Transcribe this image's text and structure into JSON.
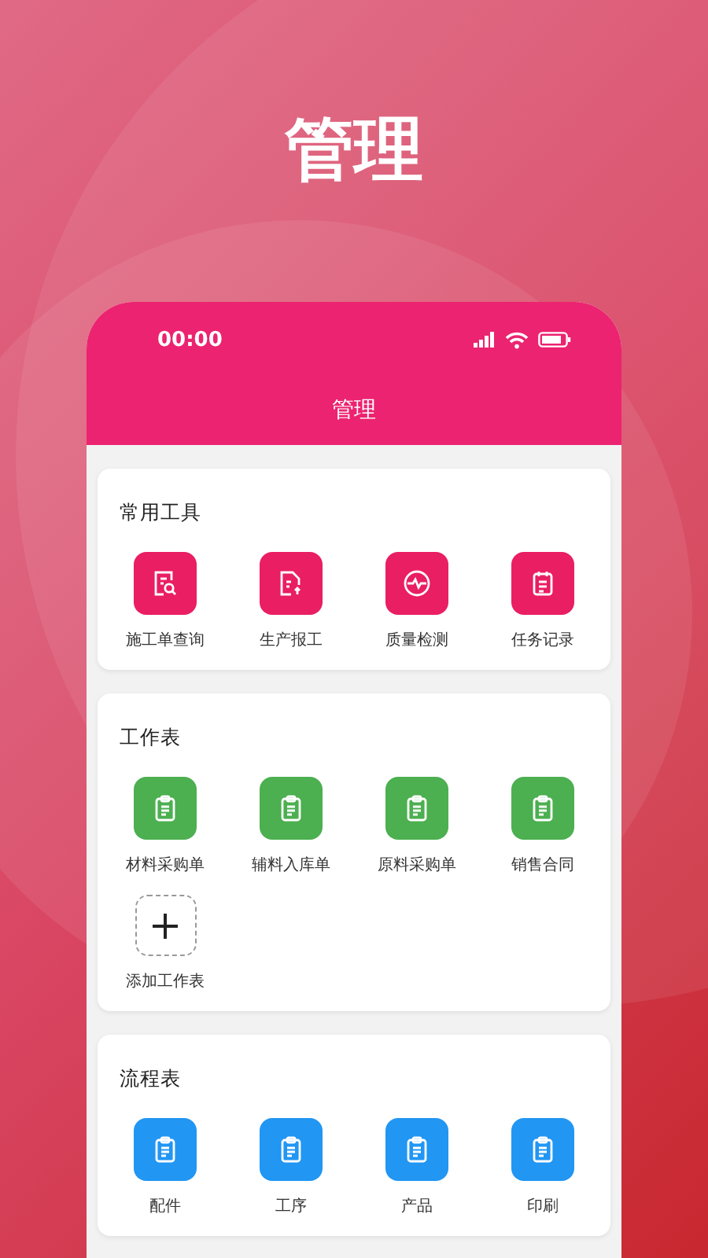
{
  "headline": "管理",
  "status_bar": {
    "time": "00:00"
  },
  "app_bar": {
    "title": "管理"
  },
  "sections": [
    {
      "title": "常用工具",
      "color": "#e91e63",
      "items": [
        {
          "label": "施工单查询",
          "kind": "search"
        },
        {
          "label": "生产报工",
          "kind": "upload"
        },
        {
          "label": "质量检测",
          "kind": "pulse"
        },
        {
          "label": "任务记录",
          "kind": "notes"
        }
      ]
    },
    {
      "title": "工作表",
      "color": "#4caf50",
      "items": [
        {
          "label": "材料采购单",
          "kind": "clipboard"
        },
        {
          "label": "辅料入库单",
          "kind": "clipboard"
        },
        {
          "label": "原料采购单",
          "kind": "clipboard"
        },
        {
          "label": "销售合同",
          "kind": "clipboard"
        },
        {
          "label": "添加工作表",
          "kind": "add"
        }
      ]
    },
    {
      "title": "流程表",
      "color": "#2196f3",
      "items": [
        {
          "label": "配件",
          "kind": "clipboard"
        },
        {
          "label": "工序",
          "kind": "clipboard"
        },
        {
          "label": "产品",
          "kind": "clipboard"
        },
        {
          "label": "印刷",
          "kind": "clipboard"
        }
      ]
    }
  ]
}
